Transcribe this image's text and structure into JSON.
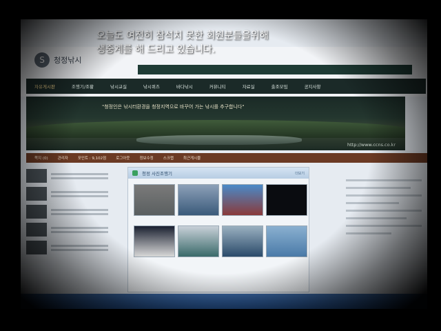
{
  "caption": {
    "line1": "오늘도 여전히 참석치 못한 회원분들을위해",
    "line2": "생중계를 해 드리고 있습니다."
  },
  "site": {
    "logo_text": "청정낚시",
    "nav": [
      "자유게시판",
      "조행기/조황",
      "낚시교실",
      "낚시퀴즈",
      "바다낚시",
      "커뮤니티",
      "자료실",
      "출조모임",
      "공지사항"
    ],
    "banner_quote": "\"청정인은 낚시터환경을 청정지역으로 바꾸어 가는 낚시를 추구합니다\"",
    "banner_url": "http://www.ccns.co.kr",
    "info": [
      "쪽지 (0)",
      "관리자",
      "포인트 : 9,102점",
      "로그아웃",
      "정보수정",
      "스크랩",
      "최근게시물"
    ],
    "gallery_title": "청정 사진조행기",
    "gallery_more": "더보기"
  },
  "colors": {
    "nav_bg": "#1b2a28",
    "info_bg": "#6b3a24",
    "gallery_header": "#b7cde3",
    "taskbar": "#2b5a98"
  }
}
